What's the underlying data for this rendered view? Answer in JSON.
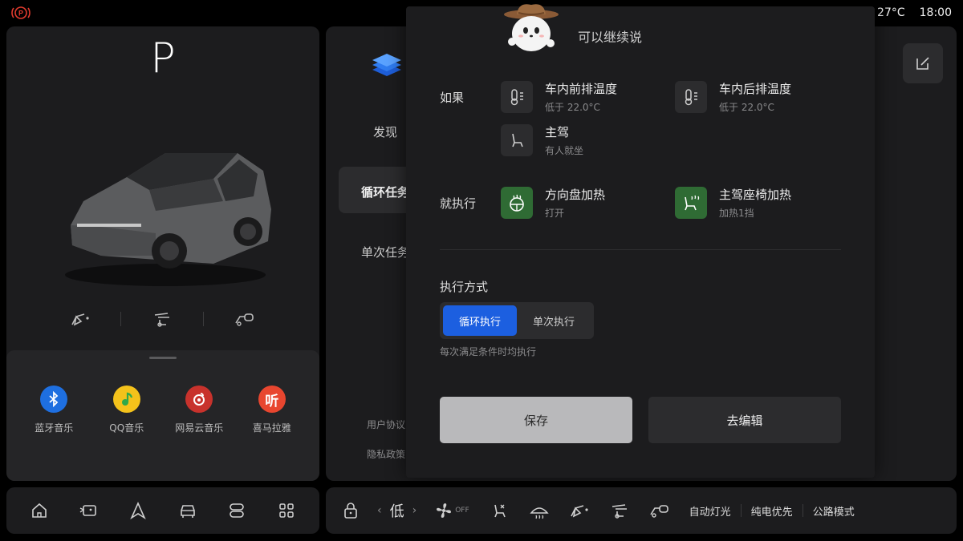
{
  "status_bar": {
    "parking_brake_icon": "parking-brake-icon",
    "temperature": "27°C",
    "time": "18:00"
  },
  "vehicle": {
    "gear": "P",
    "controls": [
      "front-door-icon",
      "tailgate-icon",
      "charge-port-icon"
    ]
  },
  "media": {
    "apps": [
      {
        "label": "蓝牙音乐",
        "icon": "bluetooth-icon",
        "color": "#1e6fe0"
      },
      {
        "label": "QQ音乐",
        "icon": "qq-music-icon",
        "color": "#f4c21b"
      },
      {
        "label": "网易云音乐",
        "icon": "netease-music-icon",
        "color": "#c8322c"
      },
      {
        "label": "喜马拉雅",
        "icon": "ximalaya-icon",
        "color": "#e8462f"
      }
    ]
  },
  "side_nav": {
    "items": [
      "发现",
      "循环任务",
      "单次任务"
    ],
    "active_index": 1,
    "footer_links": [
      "用户协议",
      "隐私政策"
    ]
  },
  "modal": {
    "hint": "可以继续说",
    "if_label": "如果",
    "conditions": [
      {
        "title": "车内前排温度",
        "subtitle": "低于 22.0°C",
        "icon": "thermometer-icon"
      },
      {
        "title": "车内后排温度",
        "subtitle": "低于 22.0°C",
        "icon": "thermometer-icon"
      },
      {
        "title": "主驾",
        "subtitle": "有人就坐",
        "icon": "seat-icon"
      }
    ],
    "then_label": "就执行",
    "actions": [
      {
        "title": "方向盘加热",
        "subtitle": "打开",
        "icon": "steering-wheel-heat-icon"
      },
      {
        "title": "主驾座椅加热",
        "subtitle": "加热1挡",
        "icon": "seat-heat-icon"
      }
    ],
    "mode_label": "执行方式",
    "mode_options": [
      "循环执行",
      "单次执行"
    ],
    "mode_active_index": 0,
    "mode_hint": "每次满足条件时均执行",
    "save_label": "保存",
    "edit_label": "去编辑",
    "accent_color": "#1c5fe0"
  },
  "dock_left": [
    "home-icon",
    "media-icon",
    "navigation-icon",
    "car-icon",
    "apps-toggle-icon",
    "grid-icon"
  ],
  "dock_right": {
    "fan_level": "低",
    "fan_state": "OFF",
    "text_buttons": [
      "自动灯光",
      "纯电优先",
      "公路模式"
    ]
  }
}
